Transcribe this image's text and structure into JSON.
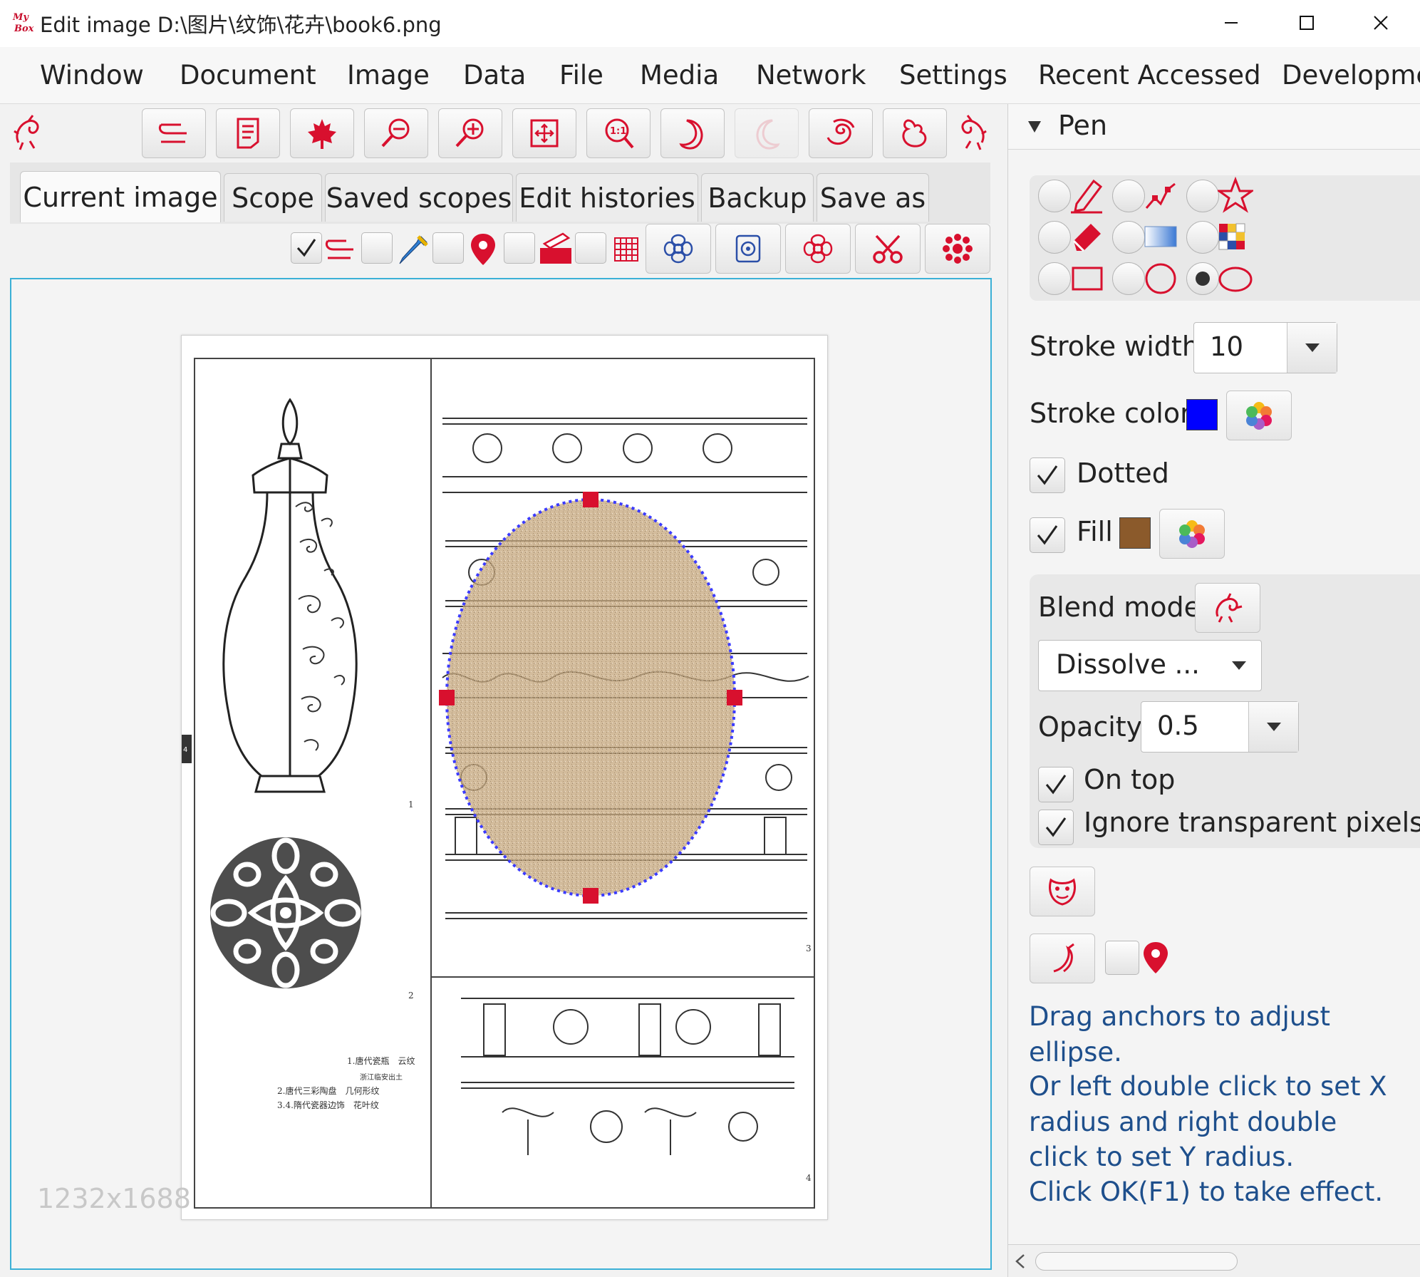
{
  "window": {
    "title": "Edit image D:\\图片\\纹饰\\花卉\\book6.png",
    "logo_text": "MyBox",
    "controls": {
      "minimize": "—",
      "maximize": "☐",
      "close": "✕"
    }
  },
  "menu": [
    "Window",
    "Document",
    "Image",
    "Data",
    "File",
    "Media",
    "Network",
    "Settings",
    "Recent Accessed",
    "Developme"
  ],
  "tabs": [
    "Current image",
    "Scope",
    "Saved scopes",
    "Edit histories",
    "Backup",
    "Save as"
  ],
  "canvas": {
    "image_size": "1232x1688",
    "page_captions": {
      "line1": "1.唐代瓷瓶　云纹",
      "line2": "浙江临安出土",
      "line3": "2.唐代三彩陶盘　几何形纹",
      "line4": "3.4.隋代瓷器边饰　花叶纹"
    },
    "page_numbers": [
      "1",
      "2",
      "3",
      "4"
    ],
    "side_marker": "4"
  },
  "pen_panel": {
    "header": "Pen",
    "stroke_width_label": "Stroke width",
    "stroke_width_value": "10",
    "stroke_color_label": "Stroke color",
    "stroke_color": "#0000ff",
    "dotted_label": "Dotted",
    "dotted_checked": true,
    "fill_label": "Fill",
    "fill_checked": true,
    "fill_color": "#8b5a2b",
    "blend_mode_label": "Blend mode",
    "blend_mode_value": "Dissolve ...",
    "opacity_label": "Opacity",
    "opacity_value": "0.5",
    "on_top_label": "On top",
    "on_top_checked": true,
    "ignore_transparent_label": "Ignore transparent pixels",
    "ignore_transparent_checked": true,
    "selected_shape": "ellipse"
  },
  "hints": {
    "line1": "Drag anchors to adjust ellipse.",
    "line2": "Or left double click to set X radius and right double click to set Y radius.",
    "line3": "Click OK(F1) to take effect."
  },
  "colors": {
    "accent_red": "#d8102e",
    "canvas_border": "#3bb0d6",
    "hint_text": "#1e4f8c",
    "ellipse_border": "#3b3bff"
  }
}
